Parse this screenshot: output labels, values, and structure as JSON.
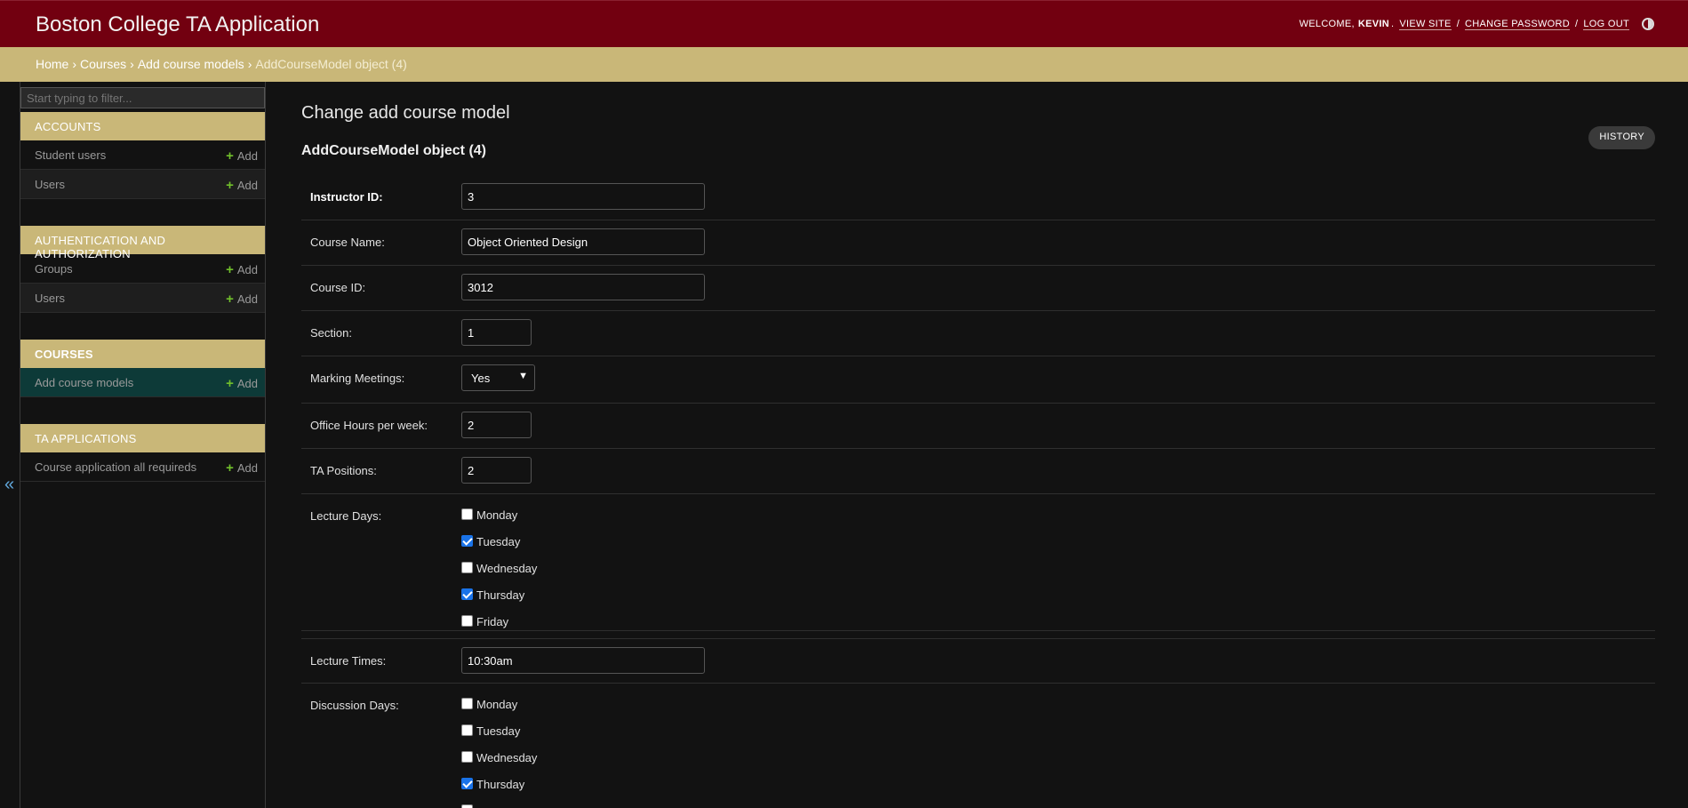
{
  "header": {
    "branding": "Boston College TA Application",
    "welcome": "Welcome,",
    "username": "Kevin",
    "view_site": "View site",
    "change_password": "Change password",
    "log_out": "Log out"
  },
  "breadcrumbs": {
    "home": "Home",
    "app": "Courses",
    "model": "Add course models",
    "current": "AddCourseModel object (4)"
  },
  "sidebar": {
    "filter_placeholder": "Start typing to filter...",
    "add_label": "Add",
    "modules": [
      {
        "caption": "Accounts",
        "items": [
          "Student users",
          "Users"
        ]
      },
      {
        "caption": "Authentication and Authorization",
        "items": [
          "Groups",
          "Users"
        ]
      },
      {
        "caption": "Courses",
        "items": [
          "Add course models"
        ]
      },
      {
        "caption": "TA Applications",
        "items": [
          "Course application all requireds"
        ]
      }
    ],
    "collapse_glyph": "«"
  },
  "main": {
    "page_title": "Change add course model",
    "object_title": "AddCourseModel object (4)",
    "history_label": "History",
    "fields": {
      "instructor_id": {
        "label": "Instructor ID:",
        "value": "3"
      },
      "course_name": {
        "label": "Course Name:",
        "value": "Object Oriented Design"
      },
      "course_id": {
        "label": "Course ID:",
        "value": "3012"
      },
      "section": {
        "label": "Section:",
        "value": "1"
      },
      "marking_meetings": {
        "label": "Marking Meetings:",
        "value": "Yes"
      },
      "office_hours": {
        "label": "Office Hours per week:",
        "value": "2"
      },
      "ta_positions": {
        "label": "TA Positions:",
        "value": "2"
      },
      "lecture_days": {
        "label": "Lecture Days:",
        "options": [
          {
            "day": "Monday",
            "checked": false
          },
          {
            "day": "Tuesday",
            "checked": true
          },
          {
            "day": "Wednesday",
            "checked": false
          },
          {
            "day": "Thursday",
            "checked": true
          },
          {
            "day": "Friday",
            "checked": false
          }
        ]
      },
      "lecture_times": {
        "label": "Lecture Times:",
        "value": "10:30am"
      },
      "discussion_days": {
        "label": "Discussion Days:",
        "options": [
          {
            "day": "Monday",
            "checked": false
          },
          {
            "day": "Tuesday",
            "checked": false
          },
          {
            "day": "Wednesday",
            "checked": false
          },
          {
            "day": "Thursday",
            "checked": true
          }
        ]
      }
    }
  },
  "colors": {
    "header_bg": "#720010",
    "breadcrumb_bg": "#c9b778",
    "module_caption_bg": "#c9b778",
    "active_row_bg": "#0d3a38",
    "add_plus": "#70bf2b",
    "checkbox_checked": "#1a73e8"
  }
}
